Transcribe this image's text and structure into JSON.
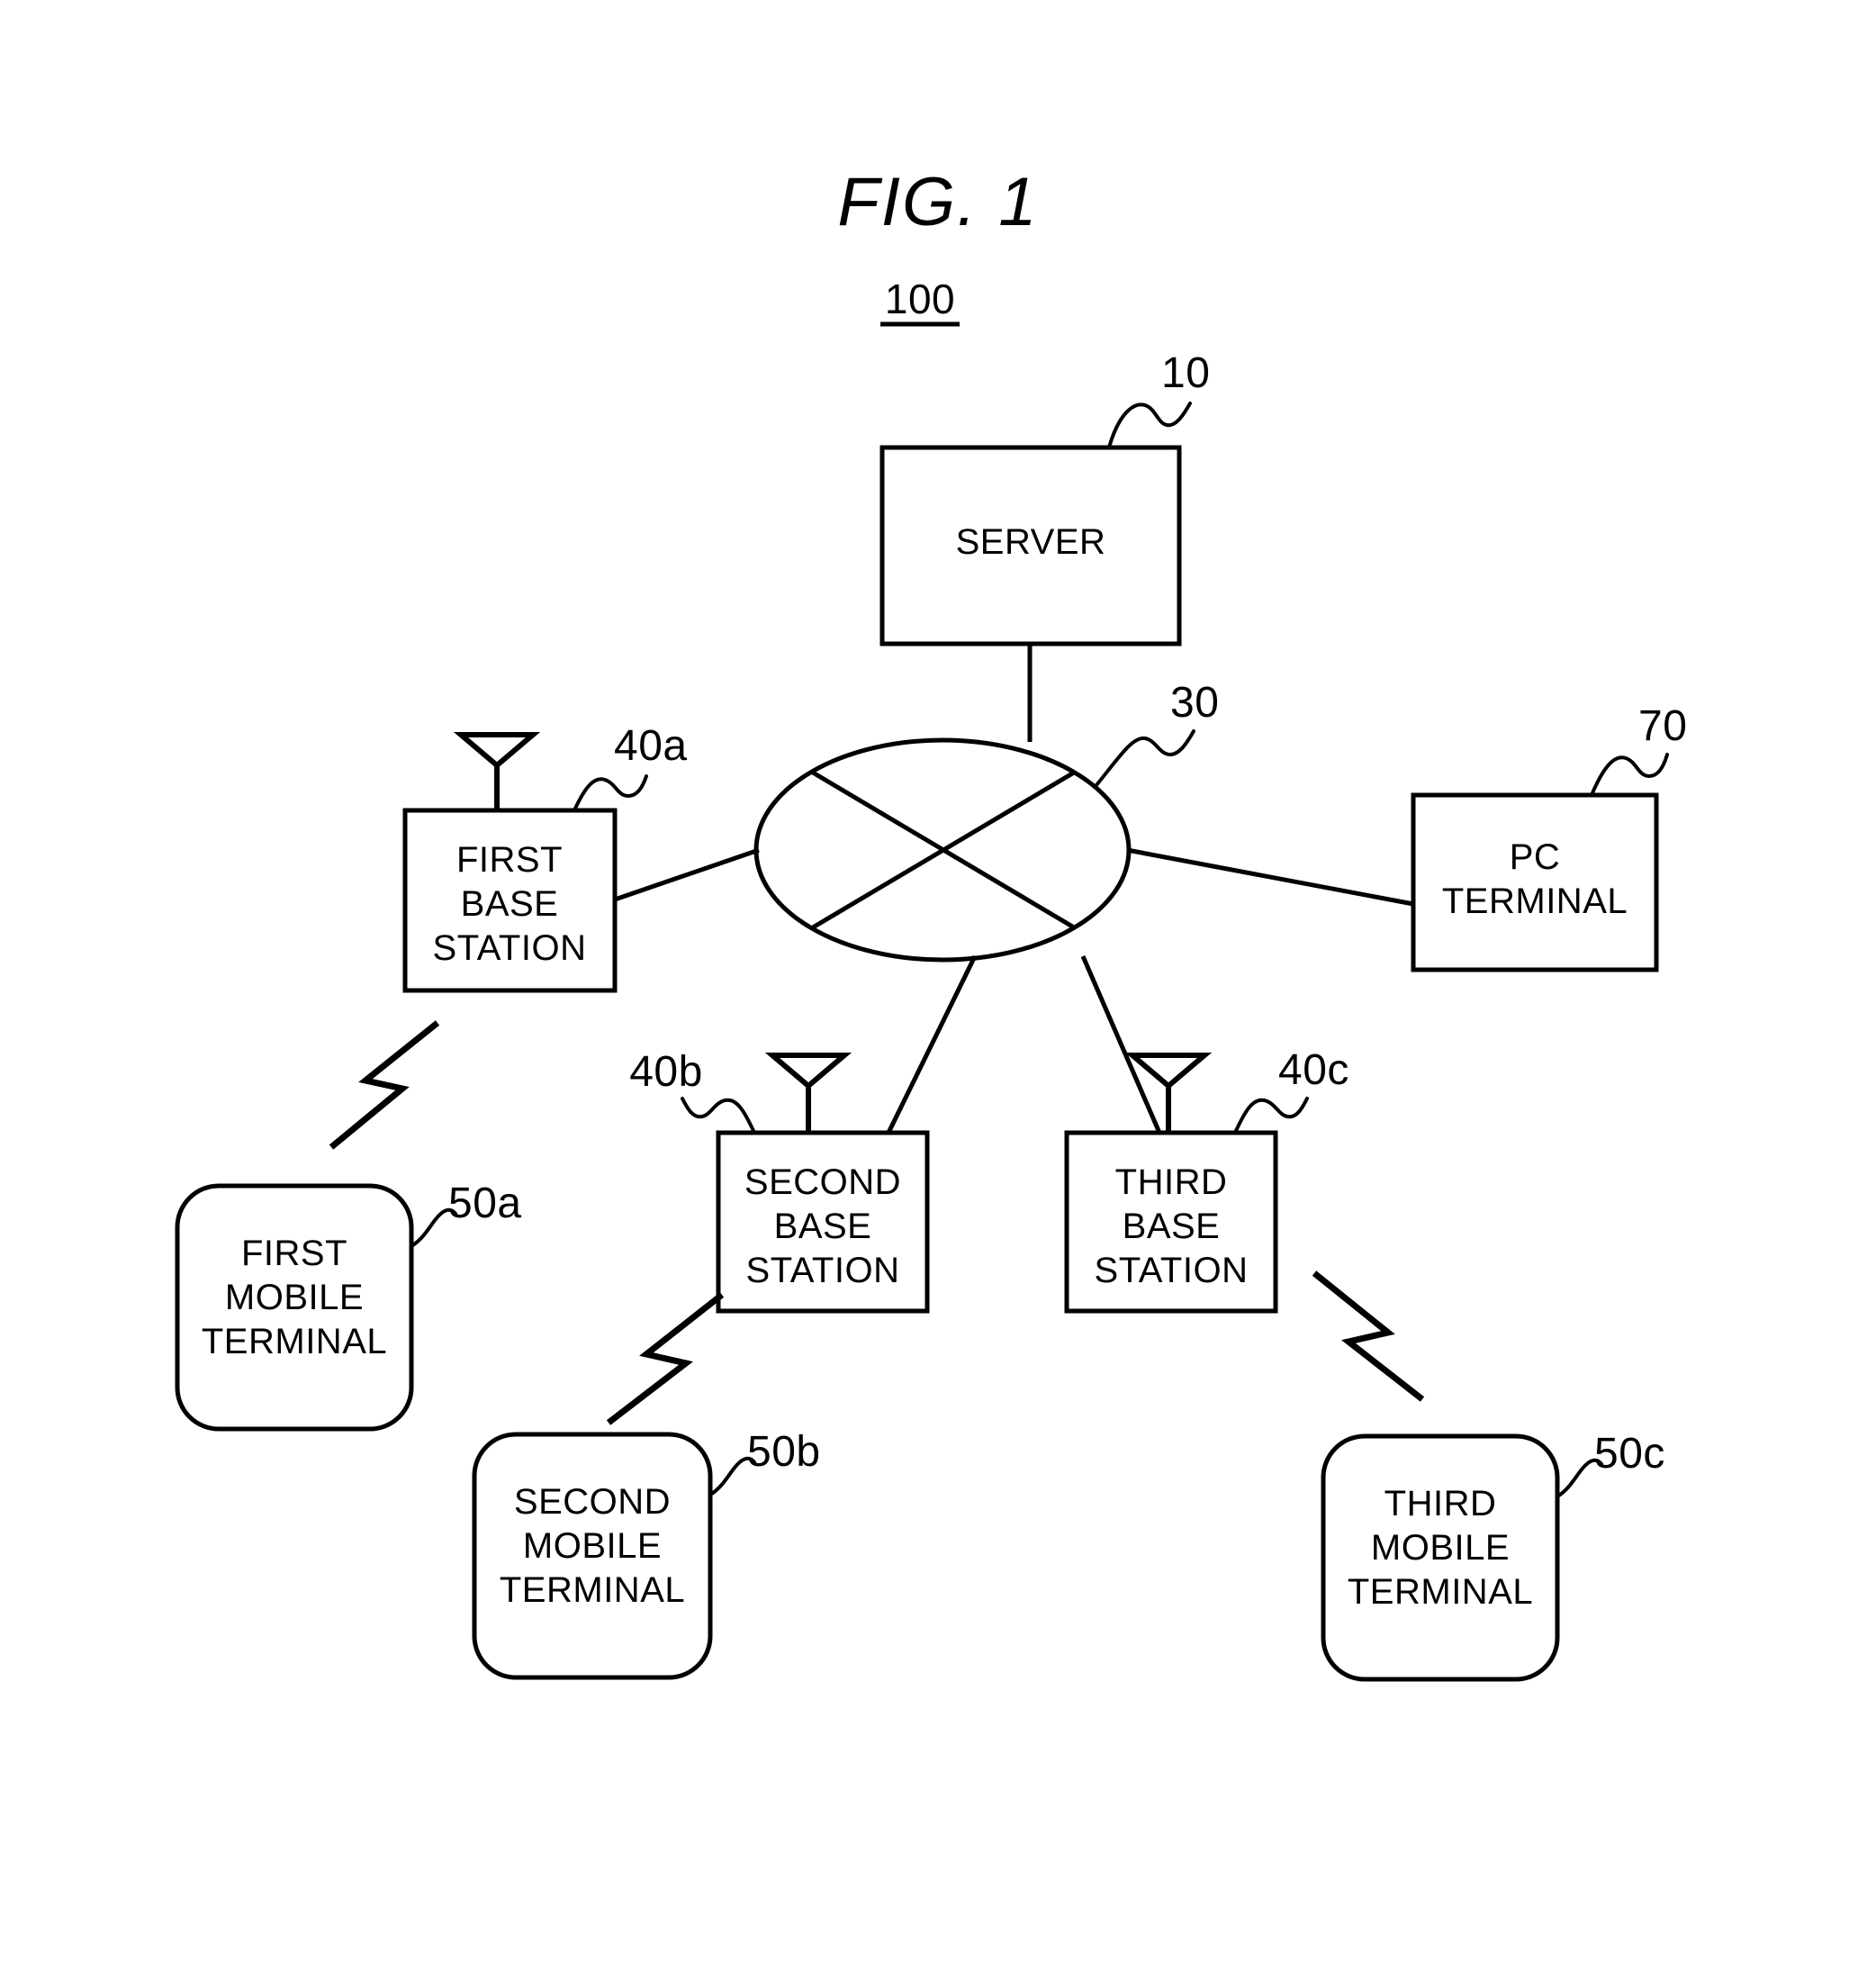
{
  "figure": {
    "title": "FIG. 1",
    "system_ref": "100"
  },
  "nodes": {
    "server": {
      "label": "SERVER",
      "ref": "10",
      "shape": "rectangle"
    },
    "network": {
      "ref": "30",
      "shape": "ellipse-with-x"
    },
    "pc_terminal": {
      "label_line1": "PC",
      "label_line2": "TERMINAL",
      "ref": "70",
      "shape": "rectangle"
    },
    "first_base_station": {
      "label_line1": "FIRST",
      "label_line2": "BASE",
      "label_line3": "STATION",
      "ref": "40a",
      "shape": "rectangle-with-antenna"
    },
    "second_base_station": {
      "label_line1": "SECOND",
      "label_line2": "BASE",
      "label_line3": "STATION",
      "ref": "40b",
      "shape": "rectangle-with-antenna"
    },
    "third_base_station": {
      "label_line1": "THIRD",
      "label_line2": "BASE",
      "label_line3": "STATION",
      "ref": "40c",
      "shape": "rectangle-with-antenna"
    },
    "first_mobile_terminal": {
      "label_line1": "FIRST",
      "label_line2": "MOBILE",
      "label_line3": "TERMINAL",
      "ref": "50a",
      "shape": "rounded-rectangle"
    },
    "second_mobile_terminal": {
      "label_line1": "SECOND",
      "label_line2": "MOBILE",
      "label_line3": "TERMINAL",
      "ref": "50b",
      "shape": "rounded-rectangle"
    },
    "third_mobile_terminal": {
      "label_line1": "THIRD",
      "label_line2": "MOBILE",
      "label_line3": "TERMINAL",
      "ref": "50c",
      "shape": "rounded-rectangle"
    }
  },
  "connections": {
    "wired": [
      "server-to-network",
      "network-to-first-base-station",
      "network-to-pc-terminal",
      "network-to-second-base-station",
      "network-to-third-base-station"
    ],
    "wireless": [
      "first-base-station-to-first-mobile-terminal",
      "second-base-station-to-second-mobile-terminal",
      "third-base-station-to-third-mobile-terminal"
    ]
  },
  "style": {
    "line_color": "#000000",
    "background": "#ffffff"
  }
}
